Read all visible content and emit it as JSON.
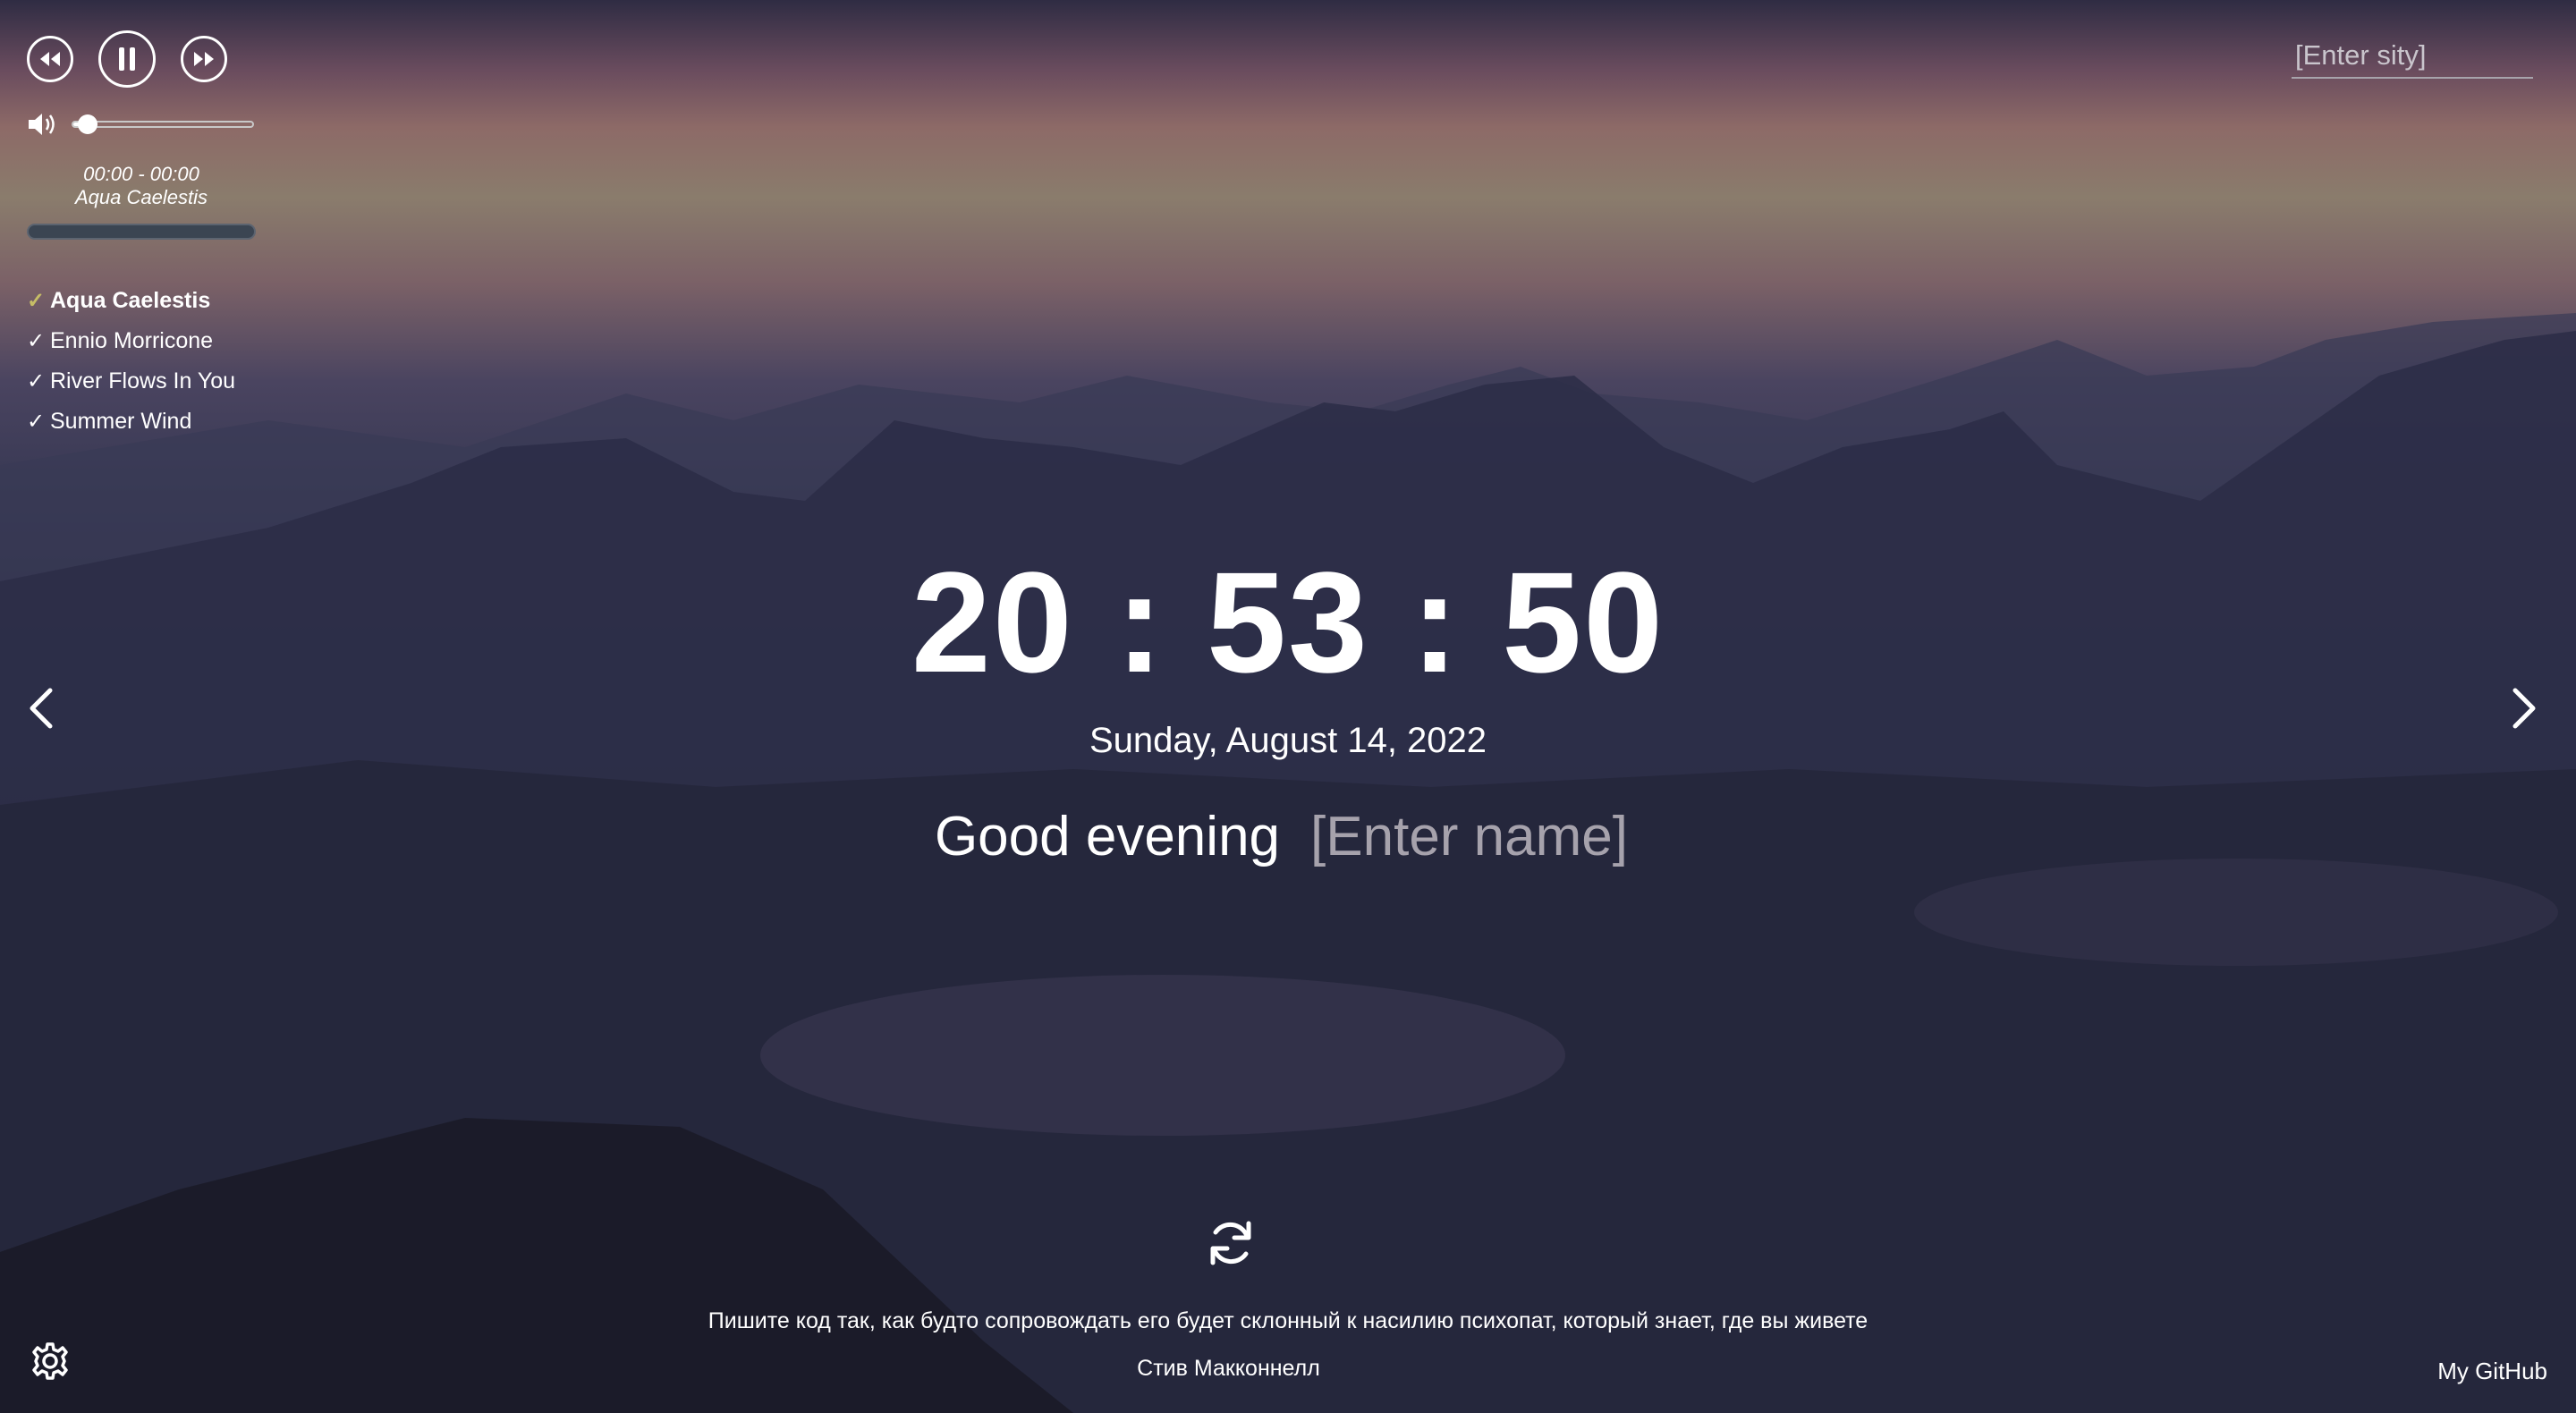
{
  "player": {
    "time_display": "00:00 - 00:00",
    "current_track": "Aqua Caelestis",
    "volume_level": 0.08,
    "progress": 0.0,
    "playlist": [
      {
        "title": "Aqua Caelestis",
        "active": true
      },
      {
        "title": "Ennio Morricone",
        "active": false
      },
      {
        "title": "River Flows In You",
        "active": false
      },
      {
        "title": "Summer Wind",
        "active": false
      }
    ],
    "icons": {
      "prev": "rewind-icon",
      "pause": "pause-icon",
      "next": "fast-forward-icon",
      "volume": "volume-icon",
      "check": "check-icon"
    }
  },
  "weather": {
    "city_placeholder": "[Enter sity]"
  },
  "clock": {
    "time": "20 : 53 : 50",
    "date": "Sunday, August 14, 2022"
  },
  "greeting": {
    "text": "Good evening",
    "name_placeholder": "[Enter name]"
  },
  "quote": {
    "text": "Пишите код так, как будто сопровождать его будет склонный к насилию психопат, который знает, где вы живете",
    "author": "Стив Макконнелл",
    "refresh_icon": "refresh-icon"
  },
  "footer": {
    "github_label": "My GitHub",
    "settings_icon": "gear-icon"
  },
  "slider": {
    "prev_icon": "chevron-left-icon",
    "next_icon": "chevron-right-icon"
  },
  "colors": {
    "active_check": "#c6bd66",
    "placeholder": "#a6a2ac"
  }
}
